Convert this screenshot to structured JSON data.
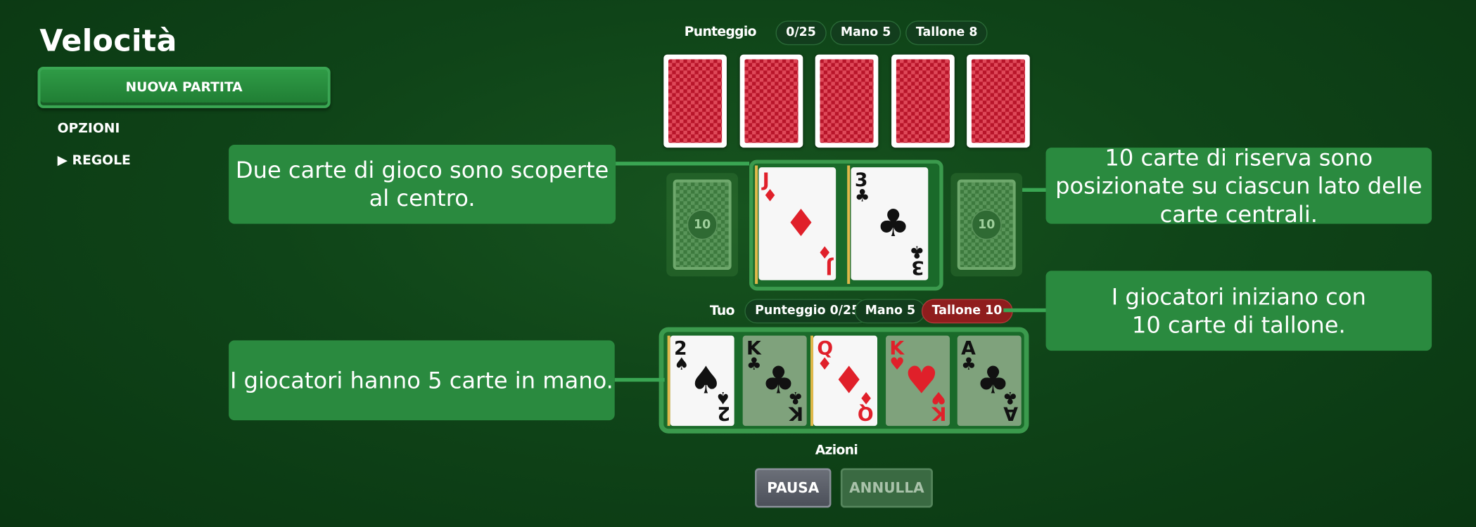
{
  "app": {
    "title": "Velocità"
  },
  "sidebar": {
    "new_game_label": "NUOVA PARTITA",
    "options_label": "OPZIONI",
    "rules_label": "▶ REGOLE"
  },
  "opponent": {
    "score_label": "Punteggio",
    "score_value": "0/25",
    "hand_label": "Mano 5",
    "deck_label": "Tallone 8",
    "hand_card_count": 5
  },
  "center": {
    "left_reserve_count": "10",
    "right_reserve_count": "10",
    "cards": [
      {
        "rank": "J",
        "suit": "♦",
        "color": "red"
      },
      {
        "rank": "3",
        "suit": "♣",
        "color": "black"
      }
    ]
  },
  "player": {
    "name_label": "Tuo",
    "score_label": "Punteggio 0/25",
    "hand_label": "Mano 5",
    "deck_label": "Tallone 10",
    "hand": [
      {
        "rank": "2",
        "suit": "♠",
        "color": "black",
        "dimmed": false
      },
      {
        "rank": "K",
        "suit": "♣",
        "color": "black",
        "dimmed": true
      },
      {
        "rank": "Q",
        "suit": "♦",
        "color": "red",
        "dimmed": false
      },
      {
        "rank": "K",
        "suit": "♥",
        "color": "red",
        "dimmed": true
      },
      {
        "rank": "A",
        "suit": "♣",
        "color": "black",
        "dimmed": true
      }
    ]
  },
  "actions": {
    "label": "Azioni",
    "pause_label": "PAUSA",
    "undo_label": "ANNULLA"
  },
  "tutorial": {
    "center_cards": "Due carte di gioco sono scoperte al centro.",
    "reserve": "10 carte di riserva sono posizionate su ciascun lato delle carte centrali.",
    "deck": "I giocatori iniziano con\n10 carte di tallone.",
    "hand": "I giocatori hanno 5 carte in mano."
  },
  "colors": {
    "felt": "#0f4418",
    "accent_green": "#2a8a3f",
    "deck_highlight": "#8f1d1d",
    "card_back": "#b8152a"
  }
}
